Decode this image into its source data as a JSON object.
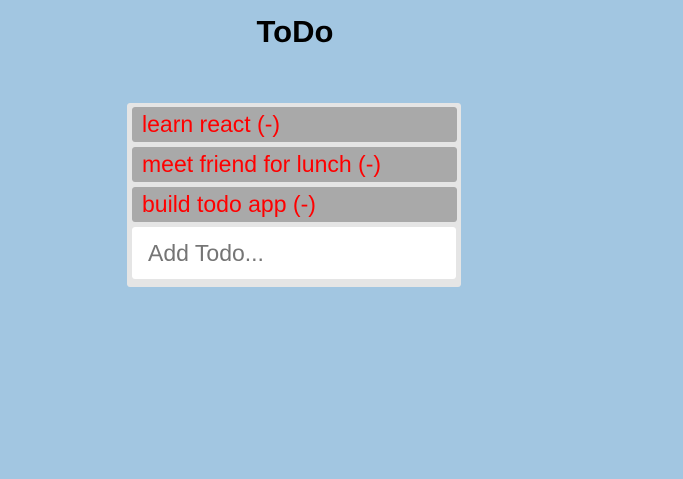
{
  "header": {
    "title": "ToDo"
  },
  "todos": [
    {
      "label": "learn react (-)"
    },
    {
      "label": "meet friend for lunch (-)"
    },
    {
      "label": "build todo app (-)"
    }
  ],
  "add_input": {
    "placeholder": "Add Todo...",
    "value": ""
  },
  "colors": {
    "background": "#a2c6e1",
    "panel": "#e5e5e5",
    "item_background": "#a9a9a9",
    "item_text": "#ff0000"
  }
}
